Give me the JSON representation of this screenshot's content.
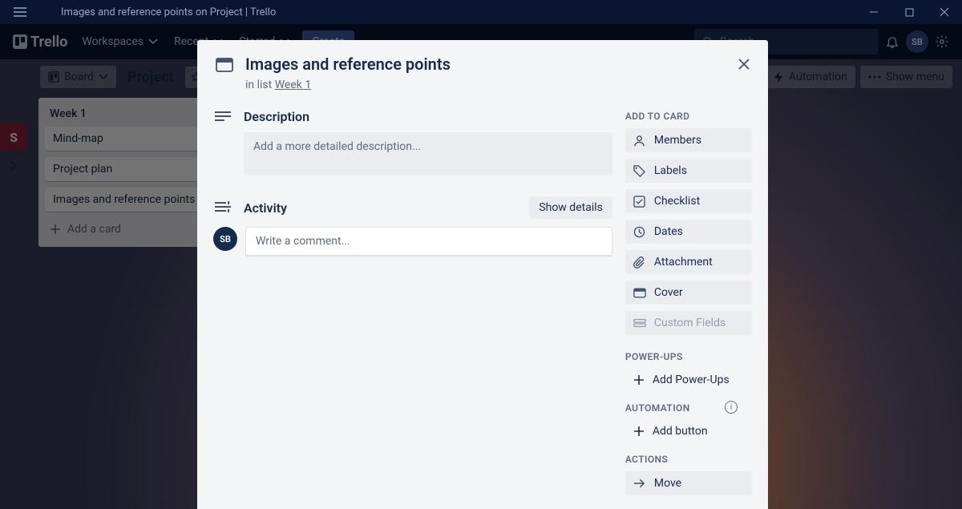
{
  "window": {
    "title": "Images and reference points on Project | Trello"
  },
  "nav": {
    "brand": "Trello",
    "workspaces": "Workspaces",
    "recent": "Recent",
    "starred": "Starred",
    "create": "Create",
    "search_placeholder": "Search",
    "avatar_initials": "SB"
  },
  "boardbar": {
    "workspace_initial": "S",
    "view_label": "Board",
    "board_title": "Project",
    "automation": "Automation",
    "show_menu": "Show menu"
  },
  "list": {
    "title": "Week 1",
    "cards": [
      "Mind-map",
      "Project plan",
      "Images and reference points"
    ],
    "add_card": "Add a card"
  },
  "modal": {
    "title": "Images and reference points",
    "in_list_prefix": "in list ",
    "in_list_name": "Week 1",
    "description_label": "Description",
    "description_placeholder": "Add a more detailed description...",
    "activity_label": "Activity",
    "show_details": "Show details",
    "comment_placeholder": "Write a comment...",
    "avatar_initials": "SB",
    "sections": {
      "add_to_card": "ADD TO CARD",
      "power_ups": "POWER-UPS",
      "automation": "AUTOMATION",
      "actions": "ACTIONS"
    },
    "side": {
      "members": "Members",
      "labels": "Labels",
      "checklist": "Checklist",
      "dates": "Dates",
      "attachment": "Attachment",
      "cover": "Cover",
      "custom_fields": "Custom Fields",
      "add_powerups": "Add Power-Ups",
      "add_button": "Add button",
      "move": "Move"
    }
  }
}
